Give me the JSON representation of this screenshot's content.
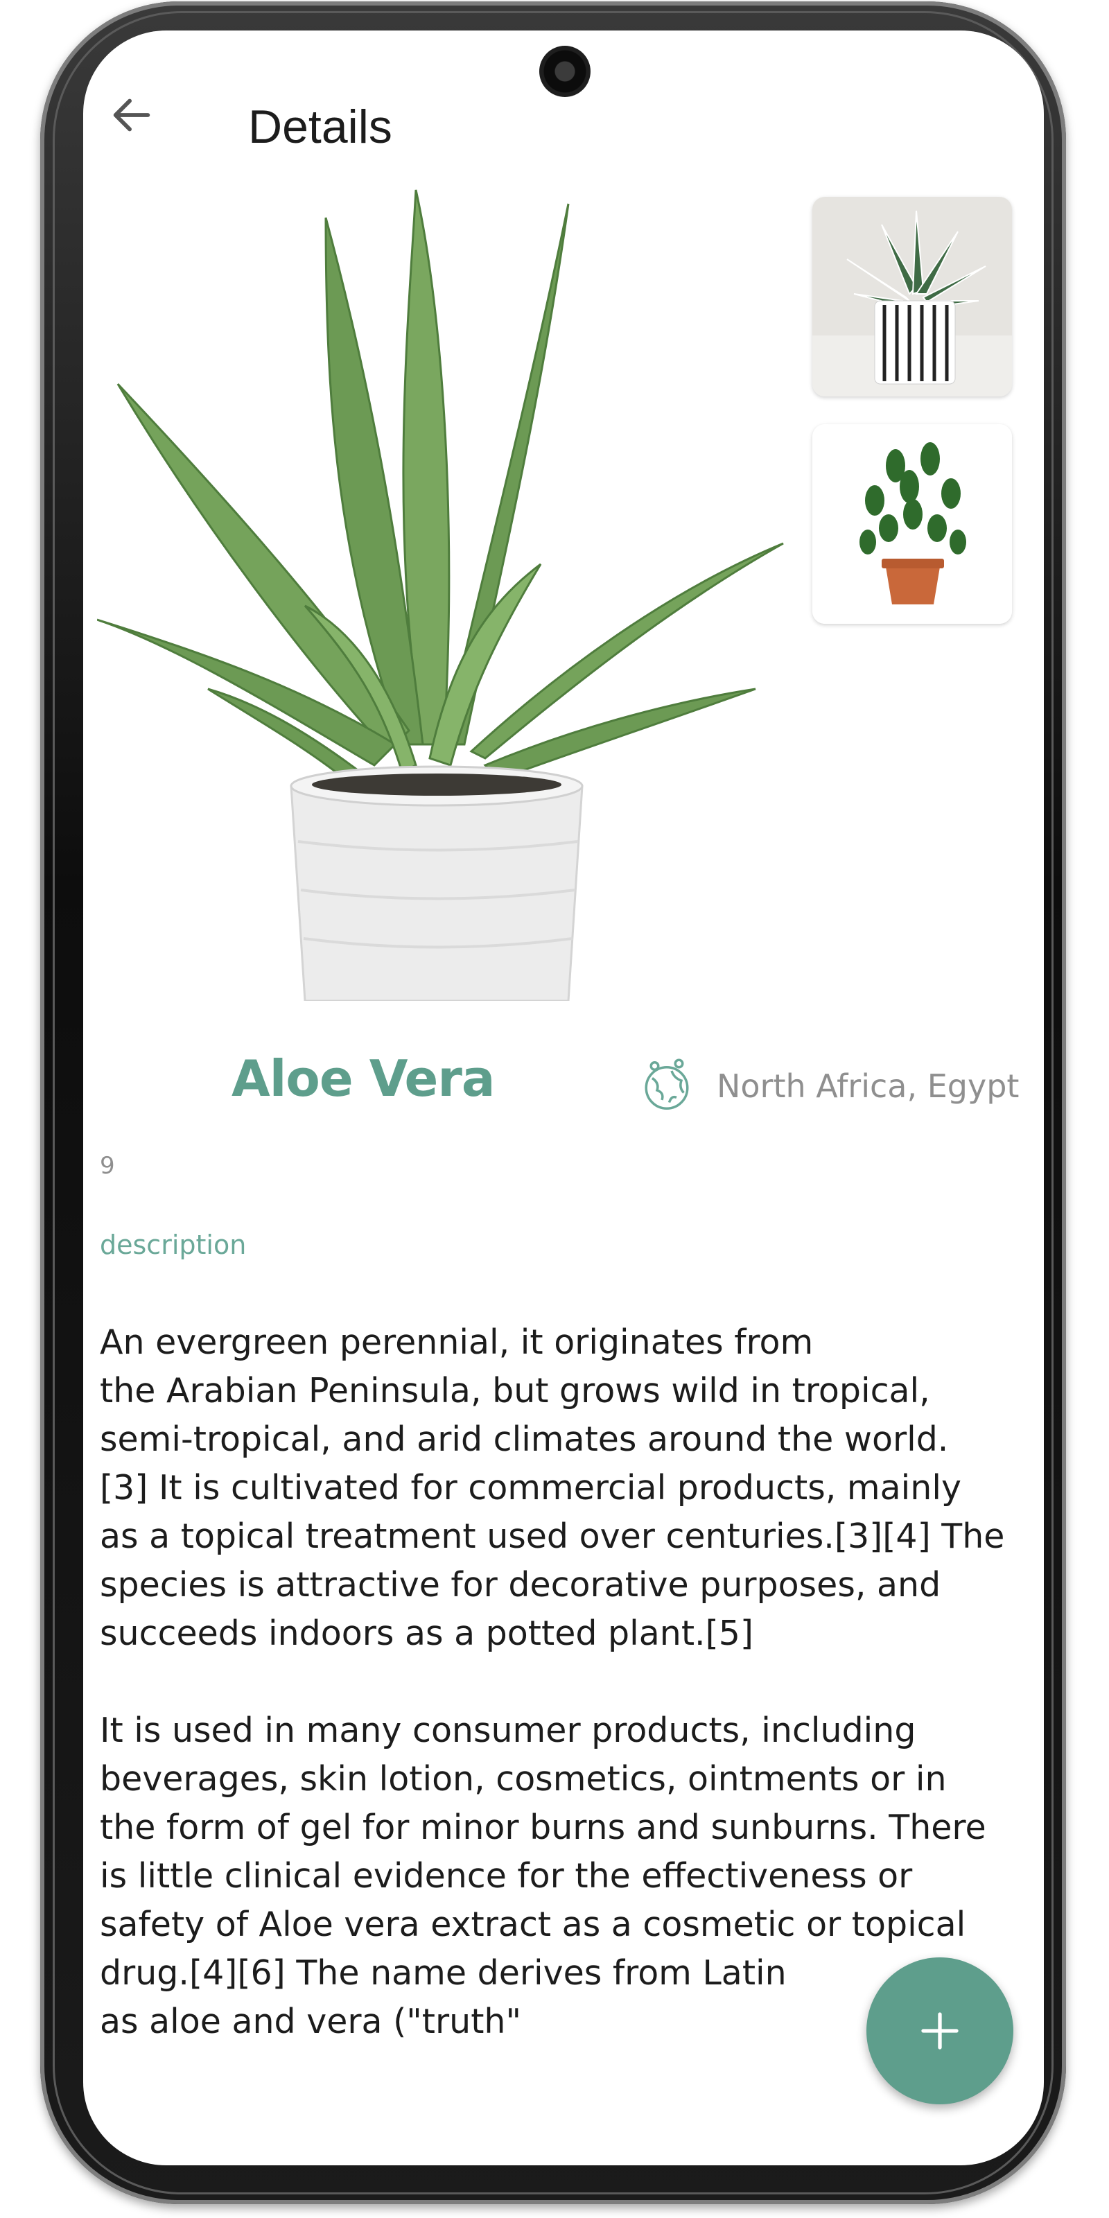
{
  "header": {
    "title": "Details",
    "back_icon": "arrow-left-icon"
  },
  "plant": {
    "name": "Aloe Vera",
    "origin": "North Africa, Egypt",
    "origin_icon": "globe-icon",
    "number": "9",
    "description_label": "description",
    "description_paragraphs": [
      "An evergreen perennial, it originates from\nthe Arabian Peninsula, but grows wild in tropical,\nsemi-tropical, and arid climates around the world.\n[3] It is cultivated for commercial products, mainly\nas a topical treatment used over centuries.[3][4] The\nspecies is attractive for decorative purposes, and\nsucceeds indoors as a potted plant.[5]",
      "It is used in many consumer products, including\nbeverages, skin lotion, cosmetics, ointments or in\nthe form of gel for minor burns and sunburns. There\nis little clinical evidence for the effectiveness or\nsafety of Aloe vera extract as a cosmetic or topical\ndrug.[4][6] The name derives from Latin\nas aloe and vera (\"truth\""
    ]
  },
  "fab": {
    "icon": "plus-icon"
  },
  "colors": {
    "accent": "#5e9e8c",
    "text": "#1c1c1c",
    "muted": "#8f8f8f"
  }
}
